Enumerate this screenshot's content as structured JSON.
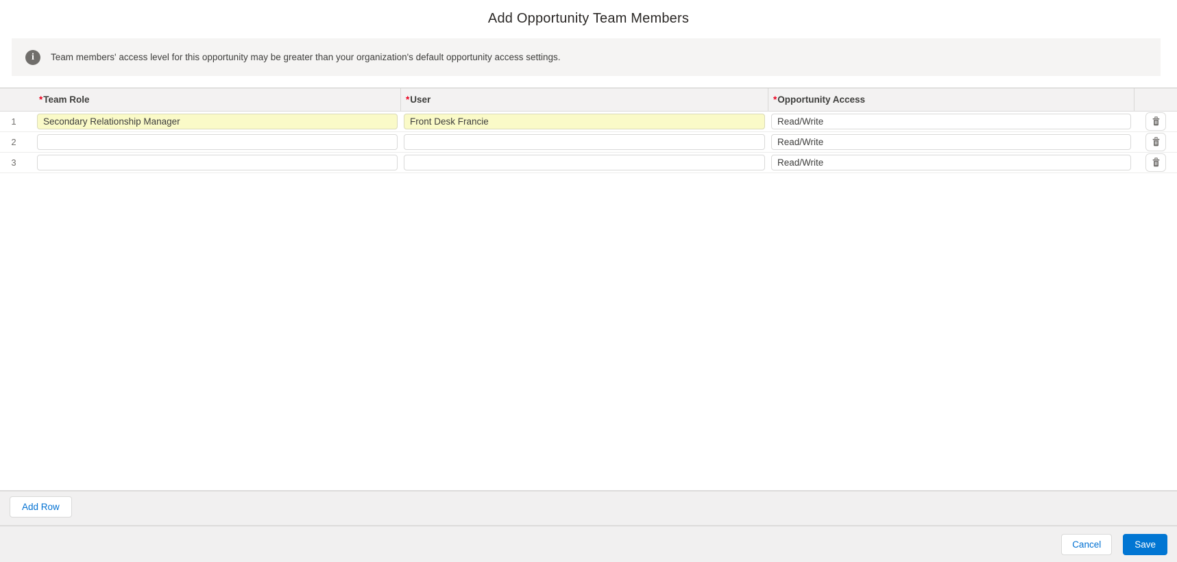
{
  "page": {
    "title": "Add Opportunity Team Members"
  },
  "banner": {
    "text": "Team members' access level for this opportunity may be greater than your organization's default opportunity access settings."
  },
  "icons": {
    "info_glyph": "i"
  },
  "table": {
    "columns": [
      {
        "marker": "*",
        "label": "Team Role"
      },
      {
        "marker": "*",
        "label": "User"
      },
      {
        "marker": "*",
        "label": "Opportunity Access"
      }
    ],
    "rows": [
      {
        "num": "1",
        "team_role": "Secondary Relationship Manager",
        "user": "Front Desk Francie",
        "opportunity_access": "Read/Write"
      },
      {
        "num": "2",
        "team_role": "",
        "user": "",
        "opportunity_access": "Read/Write"
      },
      {
        "num": "3",
        "team_role": "",
        "user": "",
        "opportunity_access": "Read/Write"
      }
    ]
  },
  "actions": {
    "add_row": "Add Row",
    "cancel": "Cancel",
    "save": "Save"
  },
  "colors": {
    "accent_blue": "#0176d3",
    "link_blue": "#0070d2",
    "required_red": "#ea001e",
    "highlight_yellow": "#fafac8",
    "band_gray": "#f1f0f0",
    "header_gray": "#f3f2f2"
  }
}
